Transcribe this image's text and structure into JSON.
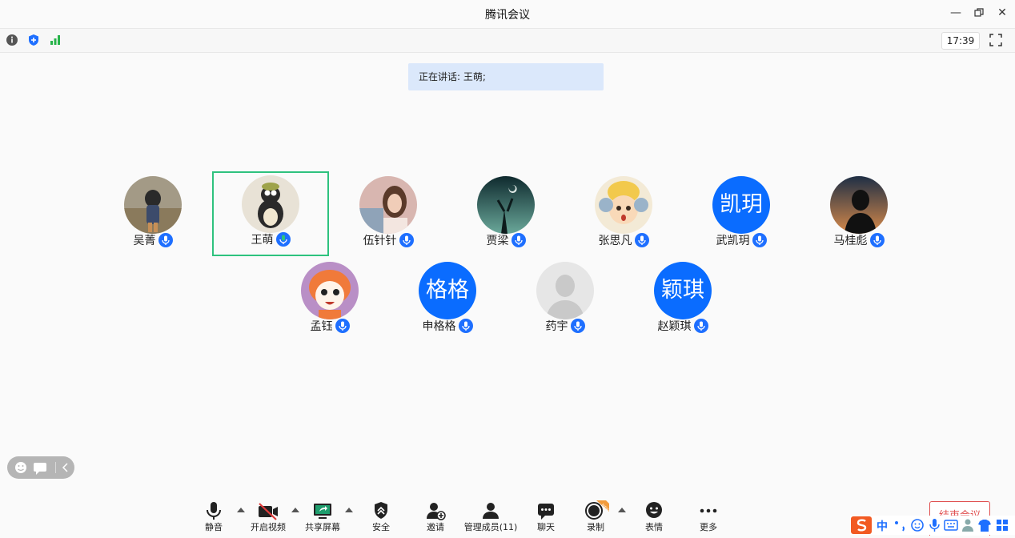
{
  "window": {
    "title": "腾讯会议"
  },
  "infobar": {
    "time": "17:39"
  },
  "banner": {
    "speaking_text": "正在讲话: 王萌;"
  },
  "participants": [
    {
      "name": "吴菁",
      "avatar_text": ""
    },
    {
      "name": "王萌",
      "avatar_text": ""
    },
    {
      "name": "伍针针",
      "avatar_text": ""
    },
    {
      "name": "贾梁",
      "avatar_text": ""
    },
    {
      "name": "张思凡",
      "avatar_text": ""
    },
    {
      "name": "武凯玥",
      "avatar_text": "凯玥"
    },
    {
      "name": "马桂彪",
      "avatar_text": ""
    },
    {
      "name": "孟钰",
      "avatar_text": ""
    },
    {
      "name": "申格格",
      "avatar_text": "格格"
    },
    {
      "name": "药宇",
      "avatar_text": ""
    },
    {
      "name": "赵颖琪",
      "avatar_text": "颖琪"
    }
  ],
  "toolbar": {
    "mute": "静音",
    "video": "开启视频",
    "share": "共享屏幕",
    "security": "安全",
    "invite": "邀请",
    "members": "管理成员(11)",
    "chat": "聊天",
    "record": "录制",
    "emoji": "表情",
    "more": "更多",
    "end": "结束会议"
  },
  "ime": {
    "mode": "中"
  },
  "colors": {
    "accent": "#1e6fff",
    "active_border": "#2ec27e",
    "end_red": "#e05050"
  }
}
